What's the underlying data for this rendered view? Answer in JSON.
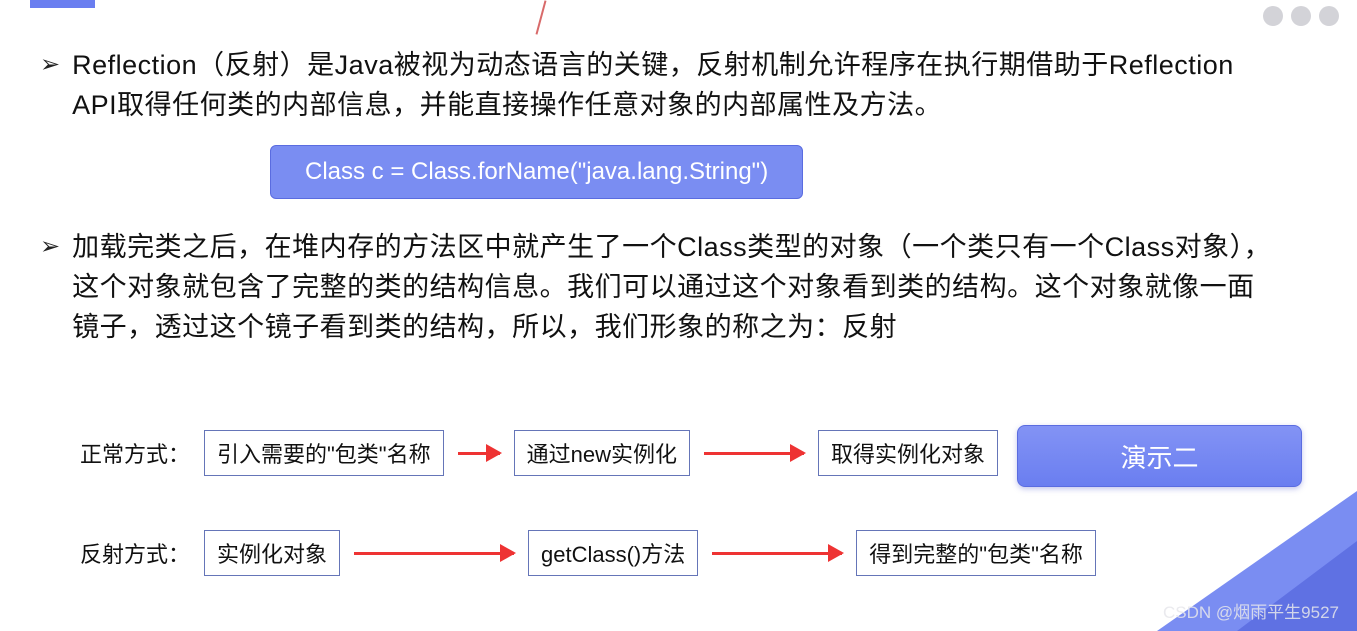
{
  "bullets": [
    "Reflection（反射）是Java被视为动态语言的关键，反射机制允许程序在执行期借助于Reflection API取得任何类的内部信息，并能直接操作任意对象的内部属性及方法。",
    "加载完类之后，在堆内存的方法区中就产生了一个Class类型的对象（一个类只有一个Class对象），这个对象就包含了完整的类的结构信息。我们可以通过这个对象看到类的结构。这个对象就像一面镜子，透过这个镜子看到类的结构，所以，我们形象的称之为：反射"
  ],
  "bullet_mark": "➢",
  "code_line": "Class c = Class.forName(\"java.lang.String\")",
  "flow_normal": {
    "label": "正常方式：",
    "steps": [
      "引入需要的\"包类\"名称",
      "通过new实例化",
      "取得实例化对象"
    ]
  },
  "flow_reflect": {
    "label": "反射方式：",
    "steps": [
      "实例化对象",
      "getClass()方法",
      "得到完整的\"包类\"名称"
    ]
  },
  "demo_button": "演示二",
  "watermark": "CSDN @烟雨平生9527"
}
